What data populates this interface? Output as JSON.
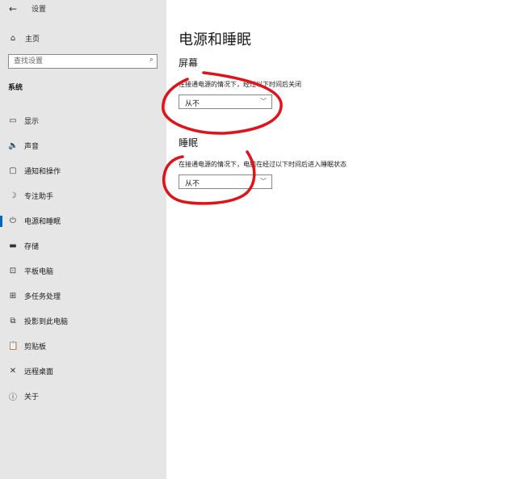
{
  "window": {
    "title": "设置",
    "back_icon": "arrow-left-icon"
  },
  "sidebar": {
    "home": {
      "label": "主页",
      "icon": "home-icon"
    },
    "search": {
      "placeholder": "查找设置",
      "icon": "search-icon"
    },
    "section_title": "系统",
    "items": [
      {
        "label": "显示",
        "icon": "monitor-icon",
        "glyph": "▭"
      },
      {
        "label": "声音",
        "icon": "speaker-icon",
        "glyph": "🔈"
      },
      {
        "label": "通知和操作",
        "icon": "notification-icon",
        "glyph": "▢"
      },
      {
        "label": "专注助手",
        "icon": "moon-icon",
        "glyph": "☽"
      },
      {
        "label": "电源和睡眠",
        "icon": "power-icon",
        "glyph": "⏻",
        "active": true
      },
      {
        "label": "存储",
        "icon": "storage-icon",
        "glyph": "▬"
      },
      {
        "label": "平板电脑",
        "icon": "tablet-icon",
        "glyph": "⊡"
      },
      {
        "label": "多任务处理",
        "icon": "multitasking-icon",
        "glyph": "⊞"
      },
      {
        "label": "投影到此电脑",
        "icon": "projector-icon",
        "glyph": "⧉"
      },
      {
        "label": "剪贴板",
        "icon": "clipboard-icon",
        "glyph": "📋"
      },
      {
        "label": "远程桌面",
        "icon": "remote-desktop-icon",
        "glyph": "✕"
      },
      {
        "label": "关于",
        "icon": "info-icon",
        "glyph": "ⓘ"
      }
    ]
  },
  "main": {
    "title": "电源和睡眠",
    "screen": {
      "heading": "屏幕",
      "description": "在接通电源的情况下，经过以下时间后关闭",
      "value": "从不"
    },
    "sleep": {
      "heading": "睡眠",
      "description": "在接通电源的情况下，电脑在经过以下时间后进入睡眠状态",
      "value": "从不"
    }
  },
  "colors": {
    "sidebar_bg": "#e6e6e6",
    "accent": "#0067c0",
    "annotation": "#e0121a"
  }
}
